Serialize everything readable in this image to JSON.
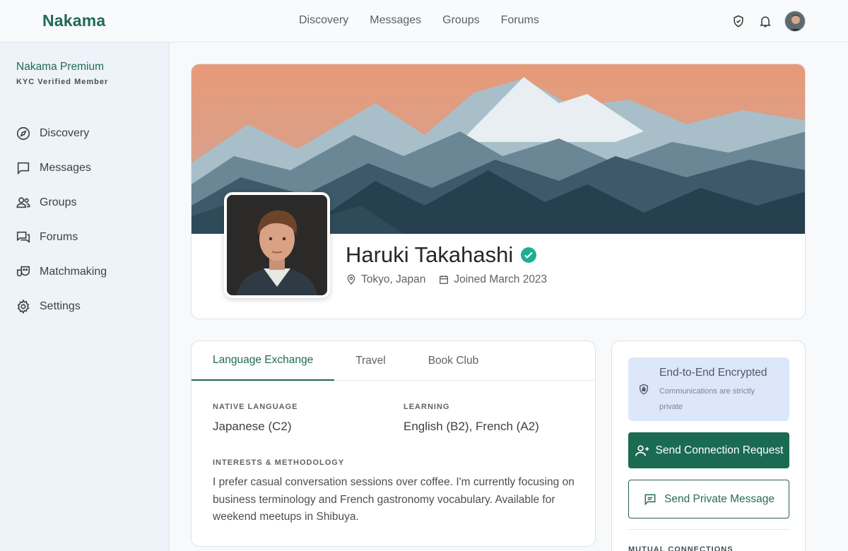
{
  "app": {
    "brand": "Nakama"
  },
  "topnav": [
    "Discovery",
    "Messages",
    "Groups",
    "Forums"
  ],
  "sidebar": {
    "premium": "Nakama Premium",
    "kyc": "KYC Verified Member",
    "items": [
      {
        "label": "Discovery",
        "icon": "compass-icon"
      },
      {
        "label": "Messages",
        "icon": "chat-icon"
      },
      {
        "label": "Groups",
        "icon": "groups-icon"
      },
      {
        "label": "Forums",
        "icon": "forum-icon"
      },
      {
        "label": "Matchmaking",
        "icon": "masks-icon"
      },
      {
        "label": "Settings",
        "icon": "gear-icon"
      }
    ]
  },
  "profile": {
    "name": "Haruki Takahashi",
    "location": "Tokyo, Japan",
    "joined": "Joined March 2023"
  },
  "tabs": [
    "Language Exchange",
    "Travel",
    "Book Club"
  ],
  "language": {
    "native_label": "NATIVE LANGUAGE",
    "native_value": "Japanese (C2)",
    "learning_label": "LEARNING",
    "learning_value": "English (B2), French (A2)",
    "interests_label": "INTERESTS & METHODOLOGY",
    "interests_text": "I prefer casual conversation sessions over coffee. I'm currently focusing on business terminology and French gastronomy vocabulary. Available for weekend meetups in Shibuya."
  },
  "actions": {
    "e2e_title": "End-to-End Encrypted",
    "e2e_sub": "Communications are strictly private",
    "connect": "Send Connection Request",
    "message": "Send Private Message",
    "mutual": "MUTUAL CONNECTIONS"
  },
  "colors": {
    "brand": "#1f6b54",
    "primary_button": "#1a6b52",
    "verified": "#1fae92",
    "encrypted_bg": "#dde7fa"
  }
}
